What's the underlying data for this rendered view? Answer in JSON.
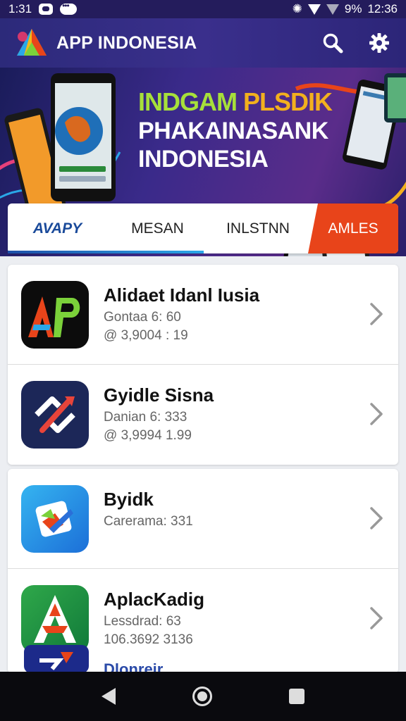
{
  "status_bar": {
    "time_left": "1:31",
    "battery": "9%",
    "time_right": "12:36"
  },
  "app_bar": {
    "title": "APP INDONESIA",
    "search_icon": "search-icon",
    "settings_icon": "gear-icon"
  },
  "banner": {
    "line1_a": "INDGAM ",
    "line1_b": "PLSDIK",
    "line2": "PHAKAINASANK",
    "line3": "INDONESIA"
  },
  "tabs": [
    {
      "label": "AVAPY",
      "active": true
    },
    {
      "label": "MESAN"
    },
    {
      "label": "INLSTNN"
    },
    {
      "label": "AMLES",
      "highlight": true
    }
  ],
  "apps": [
    {
      "title": "Alidaet Idanl Iusia",
      "line2": "Gontaa 6: 60",
      "line3": "@ 3,9004 : 19"
    },
    {
      "title": "Gyidle Sisna",
      "line2": "Danian 6: 333",
      "line3": "@ 3,9994 1.99"
    },
    {
      "title": "Byidk",
      "line2": "Carerama: 331",
      "line3": ""
    },
    {
      "title": "AplacKadig",
      "line2": "Lessdrad: 63",
      "line3": "106.3692 3136"
    }
  ],
  "partial_item": {
    "title": "Dlonreir"
  },
  "colors": {
    "appbar": "#2c2a7a",
    "accent_orange": "#e8441a",
    "headline_green": "#a7e03a",
    "headline_yellow": "#f2b01e"
  }
}
